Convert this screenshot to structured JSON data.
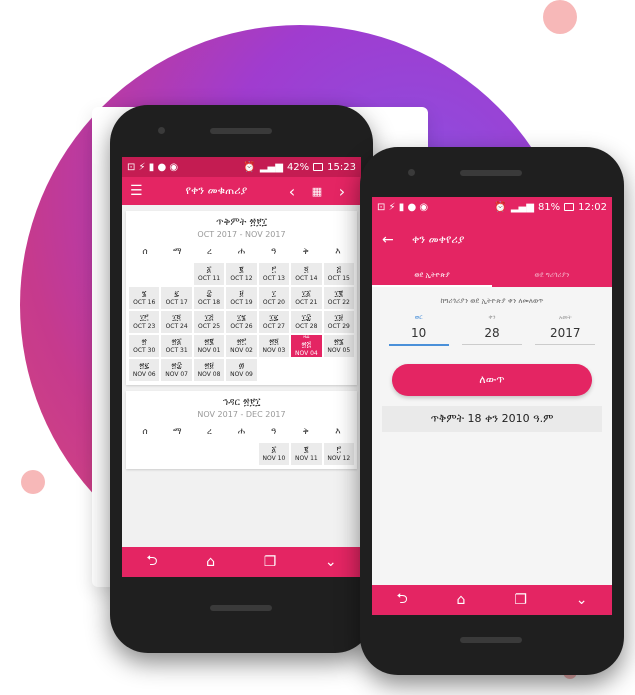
{
  "phone1": {
    "status": {
      "left_icons": "⊡ ⚡ ▮ ● ◉",
      "battery": "42%",
      "time": "15:23"
    },
    "appbar": {
      "title": "የቀን መቁጠሪያ",
      "prev": "‹",
      "next": "›"
    },
    "weekdays": [
      "ሰ",
      "ማ",
      "ረ",
      "ሐ",
      "ዓ",
      "ቅ",
      "እ"
    ],
    "month1": {
      "title": "ጥቅምት ፳፻፲",
      "subtitle": "OCT 2017 - NOV 2017",
      "days": [
        {
          "e": "",
          "g": ""
        },
        {
          "e": "",
          "g": ""
        },
        {
          "e": "፩",
          "g": "OCT 11"
        },
        {
          "e": "፪",
          "g": "OCT 12"
        },
        {
          "e": "፫",
          "g": "OCT 13"
        },
        {
          "e": "፬",
          "g": "OCT 14"
        },
        {
          "e": "፭",
          "g": "OCT 15"
        },
        {
          "e": "፮",
          "g": "OCT 16"
        },
        {
          "e": "፯",
          "g": "OCT 17"
        },
        {
          "e": "፰",
          "g": "OCT 18"
        },
        {
          "e": "፱",
          "g": "OCT 19"
        },
        {
          "e": "፲",
          "g": "OCT 20"
        },
        {
          "e": "፲፩",
          "g": "OCT 21"
        },
        {
          "e": "፲፪",
          "g": "OCT 22"
        },
        {
          "e": "፲፫",
          "g": "OCT 23"
        },
        {
          "e": "፲፬",
          "g": "OCT 24"
        },
        {
          "e": "፲፭",
          "g": "OCT 25"
        },
        {
          "e": "፲፮",
          "g": "OCT 26"
        },
        {
          "e": "፲፯",
          "g": "OCT 27"
        },
        {
          "e": "፲፰",
          "g": "OCT 28"
        },
        {
          "e": "፲፱",
          "g": "OCT 29"
        },
        {
          "e": "፳",
          "g": "OCT 30"
        },
        {
          "e": "፳፩",
          "g": "OCT 31"
        },
        {
          "e": "፳፪",
          "g": "NOV 01"
        },
        {
          "e": "፳፫",
          "g": "NOV 02"
        },
        {
          "e": "፳፬",
          "g": "NOV 03"
        },
        {
          "e": "፳፭",
          "g": "NOV 04",
          "today": true,
          "badge": "ዛሬ"
        },
        {
          "e": "፳፮",
          "g": "NOV 05"
        },
        {
          "e": "፳፯",
          "g": "NOV 06"
        },
        {
          "e": "፳፰",
          "g": "NOV 07"
        },
        {
          "e": "፳፱",
          "g": "NOV 08"
        },
        {
          "e": "፴",
          "g": "NOV 09"
        }
      ]
    },
    "month2": {
      "title": "ኅዳር ፳፻፲",
      "subtitle": "NOV 2017 - DEC 2017",
      "days": [
        {
          "e": "",
          "g": ""
        },
        {
          "e": "",
          "g": ""
        },
        {
          "e": "",
          "g": ""
        },
        {
          "e": "",
          "g": ""
        },
        {
          "e": "፩",
          "g": "NOV 10"
        },
        {
          "e": "፪",
          "g": "NOV 11"
        },
        {
          "e": "፫",
          "g": "NOV 12"
        }
      ]
    },
    "nav": [
      "⮌",
      "⌂",
      "❐",
      "⌄"
    ]
  },
  "phone2": {
    "status": {
      "left_icons": "⊡ ⚡ ▮ ● ◉",
      "battery": "81%",
      "time": "12:02"
    },
    "appbar": {
      "title": "ቀን መቀየሪያ",
      "back": "←"
    },
    "tabs": [
      "ወደ ኢትዮጵያ",
      "ወደ ግሪጎሪያን"
    ],
    "hint": "ከግሪጎሪያን ወደ ኢትዮጵያ ቀን ለመለወጥ",
    "fields": [
      {
        "label": "ወር",
        "value": "10"
      },
      {
        "label": "ቀን",
        "value": "28"
      },
      {
        "label": "አመት",
        "value": "2017"
      }
    ],
    "button": "ለውጥ",
    "result": "ጥቅምት 18 ቀን 2010 ዓ.ም",
    "nav": [
      "⮌",
      "⌂",
      "❐",
      "⌄"
    ]
  },
  "colors": {
    "accent": "#e42563",
    "status": "#c41c52",
    "circle": "#a03ccf"
  }
}
